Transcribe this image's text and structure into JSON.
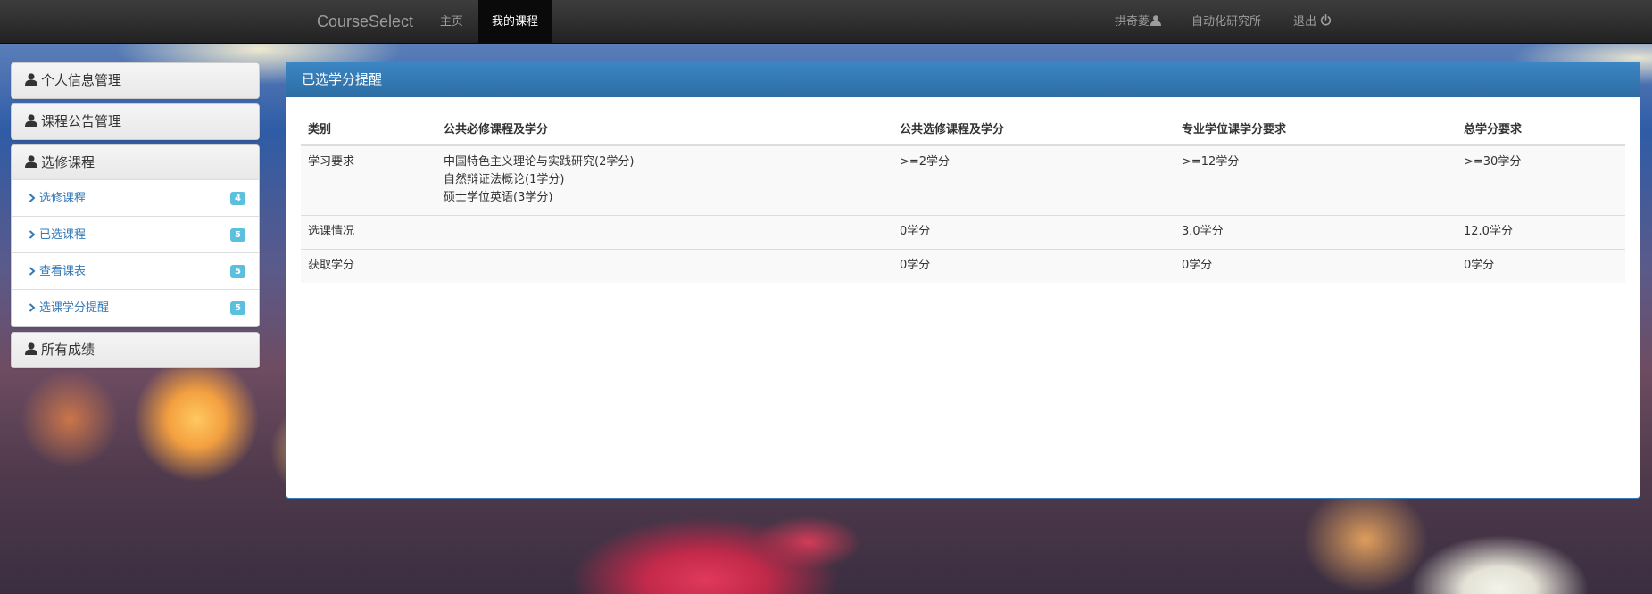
{
  "navbar": {
    "brand": "CourseSelect",
    "home": "主页",
    "my_courses": "我的课程",
    "user": "拱奇菱",
    "institute": "自动化研究所",
    "logout": "退出"
  },
  "sidebar": {
    "personal": "个人信息管理",
    "notice": "课程公告管理",
    "elective": "选修课程",
    "items": [
      {
        "label": "选修课程",
        "count": "4"
      },
      {
        "label": "已选课程",
        "count": "5"
      },
      {
        "label": "查看课表",
        "count": "5"
      },
      {
        "label": "选课学分提醒",
        "count": "5"
      }
    ],
    "grades": "所有成绩"
  },
  "main": {
    "title": "已选学分提醒",
    "columns": [
      "类别",
      "公共必修课程及学分",
      "公共选修课程及学分",
      "专业学位课学分要求",
      "总学分要求"
    ],
    "rows": [
      {
        "category": "学习要求",
        "required": [
          "中国特色主义理论与实践研究(2学分)",
          "自然辩证法概论(1学分)",
          "硕士学位英语(3学分)"
        ],
        "elective": ">=2学分",
        "major": ">=12学分",
        "total": ">=30学分"
      },
      {
        "category": "选课情况",
        "required": [],
        "elective": "0学分",
        "major": "3.0学分",
        "total": "12.0学分"
      },
      {
        "category": "获取学分",
        "required": [],
        "elective": "0学分",
        "major": "0学分",
        "total": "0学分"
      }
    ]
  }
}
